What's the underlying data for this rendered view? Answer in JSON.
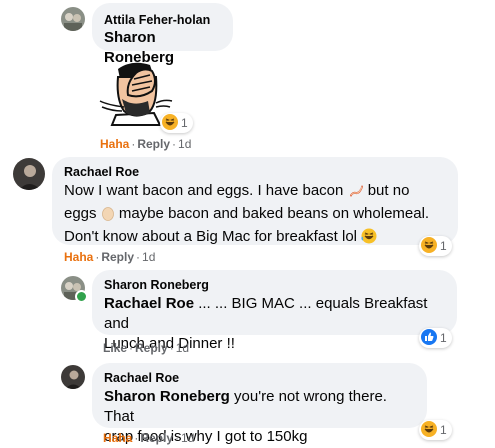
{
  "comments": [
    {
      "author": "Attila Feher-holan",
      "text": "Sharon Roneberg",
      "attachment": "bob-facepalm-gif",
      "reaction": {
        "type": "haha",
        "count": "1"
      },
      "actions": {
        "first": "Haha",
        "reply": "Reply",
        "time": "1d"
      }
    },
    {
      "author": "Rachael Roe",
      "line1": "Now I want bacon and eggs. I have bacon",
      "line1_after": "but no",
      "line2_before": "eggs",
      "line2_after": "maybe bacon and baked beans on wholemeal.",
      "line3": "Don't know about a Big Mac for breakfast lol",
      "emojis": [
        "bacon-emoji",
        "egg-emoji",
        "laughing-emoji"
      ],
      "reaction": {
        "type": "haha",
        "count": "1"
      },
      "actions": {
        "first": "Haha",
        "reply": "Reply",
        "time": "1d"
      }
    },
    {
      "author": "Sharon Roneberg",
      "mention": "Rachael Roe",
      "text": " ... ... BIG MAC ... equals Breakfast and",
      "text2": "Lunch and Dinner !!",
      "reaction": {
        "type": "like",
        "count": "1"
      },
      "actions": {
        "first": "Like",
        "reply": "Reply",
        "time": "1d"
      }
    },
    {
      "author": "Rachael Roe",
      "mention": "Sharon Roneberg",
      "text": " you're not wrong there. That",
      "text2": "crap food is why I got to 150kg",
      "reaction": {
        "type": "haha",
        "count": "1"
      },
      "actions": {
        "first": "Haha",
        "reply": "Reply",
        "time": "1d"
      }
    }
  ],
  "colors": {
    "bubble": "#f0f2f5",
    "action_gray": "#65676b",
    "haha_orange": "#e9710f",
    "like_blue": "#1877f2",
    "online_green": "#31a24c"
  }
}
